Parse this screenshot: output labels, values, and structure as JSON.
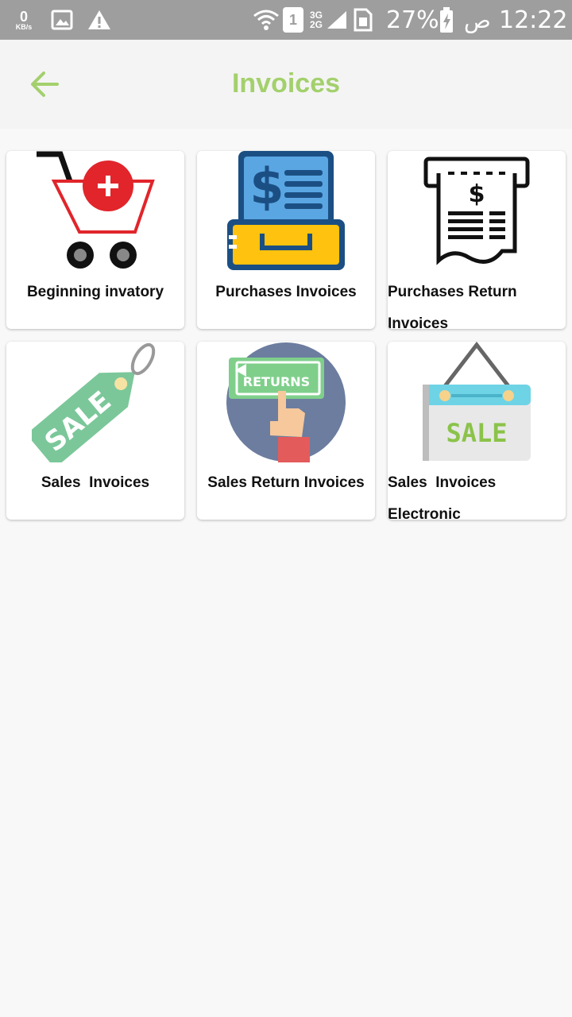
{
  "status_bar": {
    "kbs_value": "0",
    "kbs_unit": "KB/s",
    "network_3g": "3G",
    "network_2g": "2G",
    "sim_slot": "1",
    "battery": "27%",
    "ampm": "ص",
    "time": "12:22"
  },
  "header": {
    "title": "Invoices",
    "back_icon": "arrow-left-icon",
    "accent_color": "#a3d06c"
  },
  "cards": [
    {
      "label": "Beginning invatory",
      "icon": "shopping-cart-add-icon"
    },
    {
      "label": "Purchases Invoices",
      "icon": "cash-register-icon"
    },
    {
      "label": "Purchases Return\nInvoices",
      "icon": "receipt-icon"
    },
    {
      "label": "Sales  Invoices",
      "icon": "sale-tag-icon"
    },
    {
      "label": "Sales Return Invoices",
      "icon": "returns-sign-icon"
    },
    {
      "label": "Sales  Invoices\nElectronic",
      "icon": "hanging-sale-sign-icon"
    }
  ]
}
